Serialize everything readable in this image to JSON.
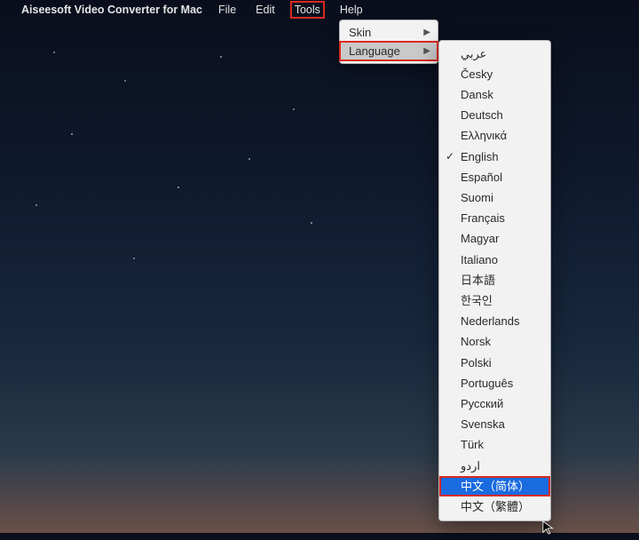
{
  "menubar": {
    "app_name": "Aiseesoft Video Converter for Mac",
    "items": [
      "File",
      "Edit",
      "Tools",
      "Help"
    ],
    "open_index": 2
  },
  "tools_menu": {
    "items": [
      {
        "label": "Skin",
        "has_sub": true
      },
      {
        "label": "Language",
        "has_sub": true,
        "hover": true,
        "highlight": true
      }
    ]
  },
  "languages": [
    {
      "label": "عربي"
    },
    {
      "label": "Česky"
    },
    {
      "label": "Dansk"
    },
    {
      "label": "Deutsch"
    },
    {
      "label": "Ελληνικά"
    },
    {
      "label": "English",
      "checked": true
    },
    {
      "label": "Español"
    },
    {
      "label": "Suomi"
    },
    {
      "label": "Français"
    },
    {
      "label": "Magyar"
    },
    {
      "label": "Italiano"
    },
    {
      "label": "日本語"
    },
    {
      "label": "한국인"
    },
    {
      "label": "Nederlands"
    },
    {
      "label": "Norsk"
    },
    {
      "label": "Polski"
    },
    {
      "label": "Português"
    },
    {
      "label": "Русский"
    },
    {
      "label": "Svenska"
    },
    {
      "label": "Türk"
    },
    {
      "label": "اردو"
    },
    {
      "label": "中文（简体）",
      "selected": true,
      "highlight": true
    },
    {
      "label": "中文（繁體）"
    }
  ],
  "highlight_color": "#d82a20",
  "selection_color": "#1a6be0"
}
